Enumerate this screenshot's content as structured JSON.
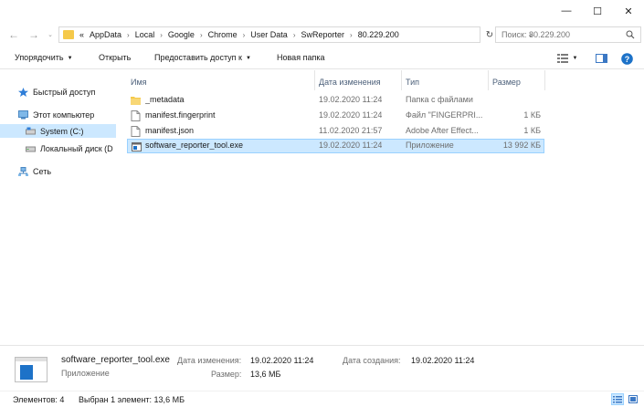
{
  "window": {
    "minimize_glyph": "—",
    "maximize_glyph": "☐",
    "close_glyph": "✕"
  },
  "nav_buttons": {
    "back": "←",
    "forward": "→"
  },
  "address": {
    "overflow": "«",
    "separator": "›",
    "parts": [
      "AppData",
      "Local",
      "Google",
      "Chrome",
      "User Data",
      "SwReporter",
      "80.229.200"
    ]
  },
  "search": {
    "placeholder": "Поиск: 80.229.200"
  },
  "commands": {
    "organize": "Упорядочить",
    "open": "Открыть",
    "share": "Предоставить доступ к",
    "new_folder": "Новая папка"
  },
  "nav_pane": {
    "quick_access": "Быстрый доступ",
    "this_pc": "Этот компьютер",
    "system_drive": "System (C:)",
    "local_disk": "Локальный диск (D",
    "network": "Сеть"
  },
  "columns": {
    "name": "Имя",
    "date": "Дата изменения",
    "type": "Тип",
    "size": "Размер"
  },
  "files": [
    {
      "icon": "folder-icon",
      "name": "_metadata",
      "date": "19.02.2020 11:24",
      "type": "Папка с файлами",
      "size": ""
    },
    {
      "icon": "file-icon",
      "name": "manifest.fingerprint",
      "date": "19.02.2020 11:24",
      "type": "Файл \"FINGERPRI...",
      "size": "1 КБ"
    },
    {
      "icon": "file-icon",
      "name": "manifest.json",
      "date": "11.02.2020 21:57",
      "type": "Adobe After Effect...",
      "size": "1 КБ"
    },
    {
      "icon": "exe-icon",
      "name": "software_reporter_tool.exe",
      "date": "19.02.2020 11:24",
      "type": "Приложение",
      "size": "13 992 КБ"
    }
  ],
  "selected_index": 3,
  "details": {
    "filename": "software_reporter_tool.exe",
    "kind": "Приложение",
    "modified_label": "Дата изменения:",
    "modified_value": "19.02.2020 11:24",
    "size_label": "Размер:",
    "size_value": "13,6 МБ",
    "created_label": "Дата создания:",
    "created_value": "19.02.2020 11:24"
  },
  "status": {
    "items": "Элементов: 4",
    "selected": "Выбран 1 элемент: 13,6 МБ"
  },
  "colors": {
    "selection": "#cce8ff",
    "selection_border": "#99d1ff",
    "folder": "#f5c94a",
    "accent": "#1d72c8"
  }
}
